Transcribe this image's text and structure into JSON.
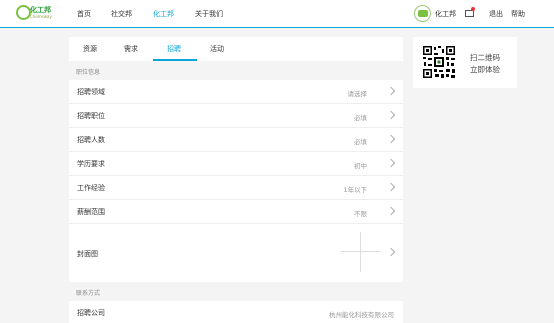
{
  "header": {
    "logo_text": "化工邦",
    "logo_sub": "Chemsway",
    "nav": [
      "首页",
      "社交邦",
      "化工邦",
      "关于我们"
    ],
    "active_nav": "化工邦",
    "user_name": "化工邦",
    "logout": "退出",
    "help": "帮助"
  },
  "tabs": [
    "资源",
    "需求",
    "招聘",
    "活动"
  ],
  "active_tab": "招聘",
  "sections": {
    "job_info": "职位信息",
    "contact": "联系方式"
  },
  "form_rows": [
    {
      "label": "招聘领域",
      "value": "请选择"
    },
    {
      "label": "招聘职位",
      "value": "必填"
    },
    {
      "label": "招聘人数",
      "value": "必填"
    },
    {
      "label": "学历要求",
      "value": "初中"
    },
    {
      "label": "工作经验",
      "value": "1年以下"
    },
    {
      "label": "薪酬范围",
      "value": "不限"
    }
  ],
  "cover": {
    "label": "封面图"
  },
  "company_row": {
    "label": "招聘公司",
    "value": "杭州能化科技有限公司"
  },
  "qr_card": {
    "line1": "扫二维码",
    "line2": "立即体验"
  },
  "colors": {
    "accent": "#0aa6d8",
    "brand_green": "#7cc242"
  }
}
